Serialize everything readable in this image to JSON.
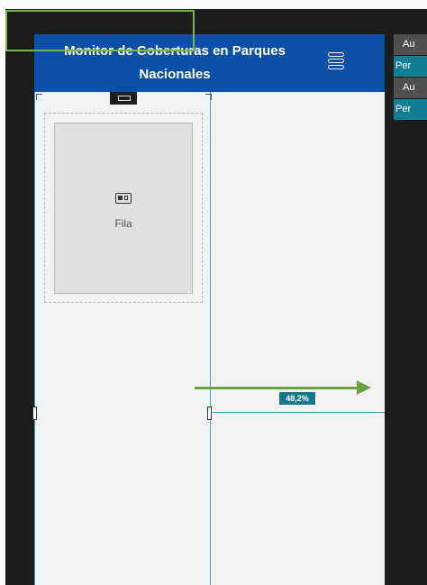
{
  "header": {
    "title": "Monitor de Coberturas en Parques Nacionales"
  },
  "widget": {
    "label": "Fila"
  },
  "measurement": {
    "percent_label": "48,2%",
    "percent_value": 48.2
  },
  "right_panel": {
    "items": [
      {
        "label": "Au"
      },
      {
        "label": "Per"
      },
      {
        "label": "Au"
      },
      {
        "label": "Per"
      }
    ]
  },
  "colors": {
    "header_bg": "#0b4fa8",
    "accent_teal": "#127f97",
    "guide_line": "#39a7b8",
    "annotation_green": "#6ea143"
  },
  "icons": [
    "menu-icon",
    "row-widget-icon",
    "resize-handle-icon",
    "arrow-right-icon"
  ]
}
